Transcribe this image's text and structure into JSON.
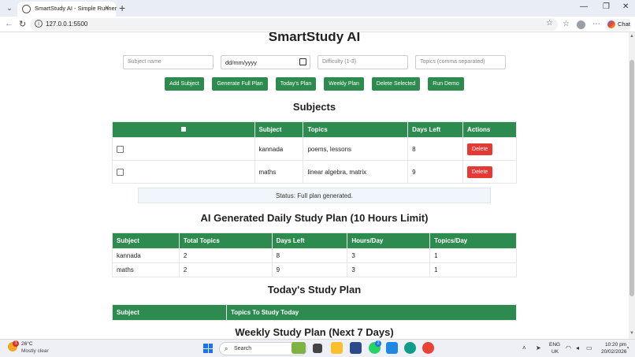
{
  "browser": {
    "tab_title": "SmartStudy AI - Simple Runner",
    "url": "127.0.0.1:5500",
    "chat_label": "Chat"
  },
  "page": {
    "title": "SmartStudy AI",
    "inputs": {
      "subject_placeholder": "Subject name",
      "date_placeholder": "dd/mm/yyyy",
      "difficulty_placeholder": "Difficulty (1-3)",
      "topics_placeholder": "Topics (comma separated)"
    },
    "buttons": [
      "Add Subject",
      "Generate Full Plan",
      "Today's Plan",
      "Weekly Plan",
      "Delete Selected",
      "Run Demo"
    ],
    "subjects_title": "Subjects",
    "subjects_table": {
      "headers": [
        "",
        "Subject",
        "Topics",
        "Days Left",
        "Actions"
      ],
      "rows": [
        {
          "subject": "kannada",
          "topics": "poems, lessons",
          "days_left": "8",
          "action": "Delete"
        },
        {
          "subject": "maths",
          "topics": "linear algebra, matrix",
          "days_left": "9",
          "action": "Delete"
        }
      ]
    },
    "status": "Status: Full plan generated.",
    "plan_title": "AI Generated Daily Study Plan (10 Hours Limit)",
    "plan_table": {
      "headers": [
        "Subject",
        "Total Topics",
        "Days Left",
        "Hours/Day",
        "Topics/Day"
      ],
      "rows": [
        [
          "kannada",
          "2",
          "8",
          "3",
          "1"
        ],
        [
          "maths",
          "2",
          "9",
          "3",
          "1"
        ]
      ]
    },
    "today_title": "Today's Study Plan",
    "today_table": {
      "headers": [
        "Subject",
        "Topics To Study Today"
      ]
    },
    "weekly_title": "Weekly Study Plan (Next 7 Days)"
  },
  "taskbar": {
    "weather_temp": "26°C",
    "weather_desc": "Mostly clear",
    "weather_badge": "3",
    "search_label": "Search",
    "lang_top": "ENG",
    "lang_bottom": "UK",
    "time": "10:20 pm",
    "date": "20/02/2026",
    "whatsapp_badge": "2"
  },
  "colors": {
    "accent_green": "#2e8b4f",
    "delete_red": "#e53935"
  }
}
